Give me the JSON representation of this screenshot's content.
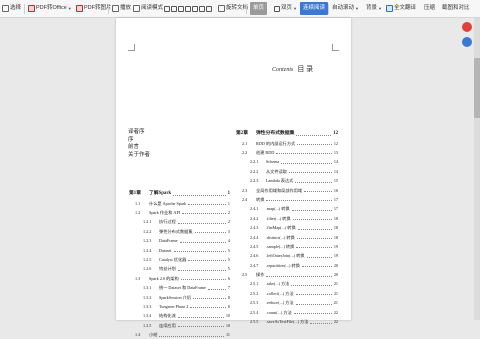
{
  "toolbar": {
    "items": [
      {
        "label": "选择"
      },
      {
        "label": "PDF转Office"
      },
      {
        "label": "PDF转图片"
      },
      {
        "label": "播放"
      },
      {
        "label": "阅读模式"
      },
      {
        "label": "旋转文档"
      },
      {
        "label": "单页"
      },
      {
        "label": "双页"
      },
      {
        "label": "连续阅读"
      },
      {
        "label": "自动滚动"
      },
      {
        "label": "背景"
      },
      {
        "label": "全文翻译"
      },
      {
        "label": "压缩"
      },
      {
        "label": "截图和对比"
      }
    ]
  },
  "page": {
    "contents_en": "Contents",
    "contents_cn": "目  录",
    "front_matter": [
      "译者序",
      "序",
      "前言",
      "关于作者"
    ],
    "left_entries": [
      {
        "num": "第1章",
        "title": "了解Spark",
        "page": "1",
        "level": 0
      },
      {
        "num": "1.1",
        "title": "什么是 Apache Spark",
        "page": "1",
        "level": 1
      },
      {
        "num": "1.2",
        "title": "Spark 作业和 API",
        "page": "2",
        "level": 1
      },
      {
        "num": "1.2.1",
        "title": "执行过程",
        "page": "2",
        "level": 2
      },
      {
        "num": "1.2.2",
        "title": "弹性分布式数据集",
        "page": "3",
        "level": 2
      },
      {
        "num": "1.2.3",
        "title": "DataFrame",
        "page": "4",
        "level": 2
      },
      {
        "num": "1.2.4",
        "title": "Dataset",
        "page": "5",
        "level": 2
      },
      {
        "num": "1.2.5",
        "title": "Catalyst 优化器",
        "page": "5",
        "level": 2
      },
      {
        "num": "1.2.6",
        "title": "钨丝计划",
        "page": "5",
        "level": 2
      },
      {
        "num": "1.3",
        "title": "Spark 2.0 的架构",
        "page": "6",
        "level": 1
      },
      {
        "num": "1.3.1",
        "title": "统一 Dataset 和 DataFrame",
        "page": "7",
        "level": 2
      },
      {
        "num": "1.3.2",
        "title": "SparkSession 介绍",
        "page": "8",
        "level": 2
      },
      {
        "num": "1.3.3",
        "title": "Tungsten Phase 2",
        "page": "8",
        "level": 2
      },
      {
        "num": "1.3.4",
        "title": "结构化流",
        "page": "10",
        "level": 2
      },
      {
        "num": "1.3.5",
        "title": "连续应用",
        "page": "10",
        "level": 2
      },
      {
        "num": "1.4",
        "title": "小结",
        "page": "11",
        "level": 1
      }
    ],
    "right_entries": [
      {
        "num": "第2章",
        "title": "弹性分布式数据集",
        "page": "12",
        "level": 0
      },
      {
        "num": "2.1",
        "title": "RDD 的内部运行方式",
        "page": "12",
        "level": 1
      },
      {
        "num": "2.2",
        "title": "创建 RDD",
        "page": "13",
        "level": 1
      },
      {
        "num": "2.2.1",
        "title": "Schema",
        "page": "14",
        "level": 2
      },
      {
        "num": "2.2.2",
        "title": "从文件读取",
        "page": "14",
        "level": 2
      },
      {
        "num": "2.2.3",
        "title": "Lambda 表达式",
        "page": "15",
        "level": 2
      },
      {
        "num": "2.3",
        "title": "全局作用域和局部作用域",
        "page": "16",
        "level": 1
      },
      {
        "num": "2.4",
        "title": "转换",
        "page": "17",
        "level": 1
      },
      {
        "num": "2.4.1",
        "title": ".map(...) 转换",
        "page": "17",
        "level": 2
      },
      {
        "num": "2.4.2",
        "title": ".filter(...) 转换",
        "page": "18",
        "level": 2
      },
      {
        "num": "2.4.3",
        "title": ".flatMap(...) 转换",
        "page": "18",
        "level": 2
      },
      {
        "num": "2.4.4",
        "title": ".distinct(...) 转换",
        "page": "18",
        "level": 2
      },
      {
        "num": "2.4.5",
        "title": ".sample(...) 转换",
        "page": "19",
        "level": 2
      },
      {
        "num": "2.4.6",
        "title": ".leftOuterJoin(...) 转换",
        "page": "19",
        "level": 2
      },
      {
        "num": "2.4.7",
        "title": ".repartition(...) 转换",
        "page": "20",
        "level": 2
      },
      {
        "num": "2.5",
        "title": "操作",
        "page": "20",
        "level": 1
      },
      {
        "num": "2.5.1",
        "title": ".take(...) 方法",
        "page": "21",
        "level": 2
      },
      {
        "num": "2.5.2",
        "title": ".collect(...) 方法",
        "page": "21",
        "level": 2
      },
      {
        "num": "2.5.3",
        "title": ".reduce(...) 方法",
        "page": "21",
        "level": 2
      },
      {
        "num": "2.5.4",
        "title": ".count(...) 方法",
        "page": "22",
        "level": 2
      },
      {
        "num": "2.5.5",
        "title": ".saveAsTextFile(...) 方法",
        "page": "22",
        "level": 2
      }
    ]
  },
  "colors": {
    "active": "#3a78d4",
    "side_red": "#e0413b",
    "side_blue": "#3a78d4"
  }
}
